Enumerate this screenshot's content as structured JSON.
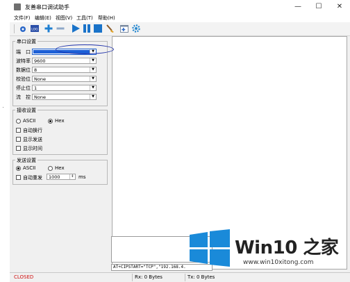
{
  "app": {
    "title": "友善串口调试助手"
  },
  "window_buttons": {
    "minimize": "—",
    "maximize": "☐",
    "close": "✕"
  },
  "menu": [
    "文件(F)",
    "编辑(E)",
    "视图(V)",
    "工具(T)",
    "帮助(H)"
  ],
  "toolbar": {
    "icons": [
      "connect-icon",
      "log-icon",
      "add-icon",
      "remove-icon",
      "start-icon",
      "pause-icon",
      "stop-icon",
      "clear-icon",
      "add-window-icon",
      "settings-icon"
    ],
    "log_label": "LOG"
  },
  "serial_settings": {
    "title": "串口设置",
    "port": {
      "label": "端　口",
      "value": ""
    },
    "baud": {
      "label": "波特率",
      "value": "9600"
    },
    "databits": {
      "label": "数据位",
      "value": "8"
    },
    "parity": {
      "label": "校验位",
      "value": "None"
    },
    "stopbits": {
      "label": "停止位",
      "value": "1"
    },
    "flow": {
      "label": "流　控",
      "value": "None"
    }
  },
  "receive_settings": {
    "title": "接收设置",
    "ascii": "ASCII",
    "hex": "Hex",
    "selected": "Hex",
    "auto_newline": "自动换行",
    "show_send": "显示发送",
    "show_time": "显示时间"
  },
  "send_settings": {
    "title": "发送设置",
    "ascii": "ASCII",
    "hex": "Hex",
    "selected": "ASCII",
    "auto_resend": "自动重发",
    "interval": "1000",
    "unit": "ms"
  },
  "command_line": "AT+CIPSTART=\"TCP\",\"192.168.4.",
  "status": {
    "connection": "CLOSED",
    "rx": "Rx: 0 Bytes",
    "tx": "Tx: 0 Bytes"
  },
  "watermark": {
    "title": "Win10 之家",
    "url": "www.win10xitong.com"
  },
  "colors": {
    "closed": "#d01010",
    "logo_blue": "#1a8ad9",
    "highlight": "#2233aa"
  }
}
